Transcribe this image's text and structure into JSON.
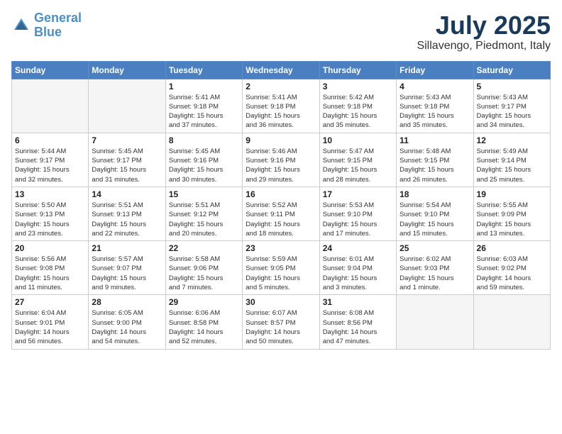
{
  "header": {
    "logo_line1": "General",
    "logo_line2": "Blue",
    "month_title": "July 2025",
    "location": "Sillavengo, Piedmont, Italy"
  },
  "weekdays": [
    "Sunday",
    "Monday",
    "Tuesday",
    "Wednesday",
    "Thursday",
    "Friday",
    "Saturday"
  ],
  "weeks": [
    [
      {
        "day": "",
        "info": ""
      },
      {
        "day": "",
        "info": ""
      },
      {
        "day": "1",
        "info": "Sunrise: 5:41 AM\nSunset: 9:18 PM\nDaylight: 15 hours\nand 37 minutes."
      },
      {
        "day": "2",
        "info": "Sunrise: 5:41 AM\nSunset: 9:18 PM\nDaylight: 15 hours\nand 36 minutes."
      },
      {
        "day": "3",
        "info": "Sunrise: 5:42 AM\nSunset: 9:18 PM\nDaylight: 15 hours\nand 35 minutes."
      },
      {
        "day": "4",
        "info": "Sunrise: 5:43 AM\nSunset: 9:18 PM\nDaylight: 15 hours\nand 35 minutes."
      },
      {
        "day": "5",
        "info": "Sunrise: 5:43 AM\nSunset: 9:17 PM\nDaylight: 15 hours\nand 34 minutes."
      }
    ],
    [
      {
        "day": "6",
        "info": "Sunrise: 5:44 AM\nSunset: 9:17 PM\nDaylight: 15 hours\nand 32 minutes."
      },
      {
        "day": "7",
        "info": "Sunrise: 5:45 AM\nSunset: 9:17 PM\nDaylight: 15 hours\nand 31 minutes."
      },
      {
        "day": "8",
        "info": "Sunrise: 5:45 AM\nSunset: 9:16 PM\nDaylight: 15 hours\nand 30 minutes."
      },
      {
        "day": "9",
        "info": "Sunrise: 5:46 AM\nSunset: 9:16 PM\nDaylight: 15 hours\nand 29 minutes."
      },
      {
        "day": "10",
        "info": "Sunrise: 5:47 AM\nSunset: 9:15 PM\nDaylight: 15 hours\nand 28 minutes."
      },
      {
        "day": "11",
        "info": "Sunrise: 5:48 AM\nSunset: 9:15 PM\nDaylight: 15 hours\nand 26 minutes."
      },
      {
        "day": "12",
        "info": "Sunrise: 5:49 AM\nSunset: 9:14 PM\nDaylight: 15 hours\nand 25 minutes."
      }
    ],
    [
      {
        "day": "13",
        "info": "Sunrise: 5:50 AM\nSunset: 9:13 PM\nDaylight: 15 hours\nand 23 minutes."
      },
      {
        "day": "14",
        "info": "Sunrise: 5:51 AM\nSunset: 9:13 PM\nDaylight: 15 hours\nand 22 minutes."
      },
      {
        "day": "15",
        "info": "Sunrise: 5:51 AM\nSunset: 9:12 PM\nDaylight: 15 hours\nand 20 minutes."
      },
      {
        "day": "16",
        "info": "Sunrise: 5:52 AM\nSunset: 9:11 PM\nDaylight: 15 hours\nand 18 minutes."
      },
      {
        "day": "17",
        "info": "Sunrise: 5:53 AM\nSunset: 9:10 PM\nDaylight: 15 hours\nand 17 minutes."
      },
      {
        "day": "18",
        "info": "Sunrise: 5:54 AM\nSunset: 9:10 PM\nDaylight: 15 hours\nand 15 minutes."
      },
      {
        "day": "19",
        "info": "Sunrise: 5:55 AM\nSunset: 9:09 PM\nDaylight: 15 hours\nand 13 minutes."
      }
    ],
    [
      {
        "day": "20",
        "info": "Sunrise: 5:56 AM\nSunset: 9:08 PM\nDaylight: 15 hours\nand 11 minutes."
      },
      {
        "day": "21",
        "info": "Sunrise: 5:57 AM\nSunset: 9:07 PM\nDaylight: 15 hours\nand 9 minutes."
      },
      {
        "day": "22",
        "info": "Sunrise: 5:58 AM\nSunset: 9:06 PM\nDaylight: 15 hours\nand 7 minutes."
      },
      {
        "day": "23",
        "info": "Sunrise: 5:59 AM\nSunset: 9:05 PM\nDaylight: 15 hours\nand 5 minutes."
      },
      {
        "day": "24",
        "info": "Sunrise: 6:01 AM\nSunset: 9:04 PM\nDaylight: 15 hours\nand 3 minutes."
      },
      {
        "day": "25",
        "info": "Sunrise: 6:02 AM\nSunset: 9:03 PM\nDaylight: 15 hours\nand 1 minute."
      },
      {
        "day": "26",
        "info": "Sunrise: 6:03 AM\nSunset: 9:02 PM\nDaylight: 14 hours\nand 59 minutes."
      }
    ],
    [
      {
        "day": "27",
        "info": "Sunrise: 6:04 AM\nSunset: 9:01 PM\nDaylight: 14 hours\nand 56 minutes."
      },
      {
        "day": "28",
        "info": "Sunrise: 6:05 AM\nSunset: 9:00 PM\nDaylight: 14 hours\nand 54 minutes."
      },
      {
        "day": "29",
        "info": "Sunrise: 6:06 AM\nSunset: 8:58 PM\nDaylight: 14 hours\nand 52 minutes."
      },
      {
        "day": "30",
        "info": "Sunrise: 6:07 AM\nSunset: 8:57 PM\nDaylight: 14 hours\nand 50 minutes."
      },
      {
        "day": "31",
        "info": "Sunrise: 6:08 AM\nSunset: 8:56 PM\nDaylight: 14 hours\nand 47 minutes."
      },
      {
        "day": "",
        "info": ""
      },
      {
        "day": "",
        "info": ""
      }
    ]
  ]
}
